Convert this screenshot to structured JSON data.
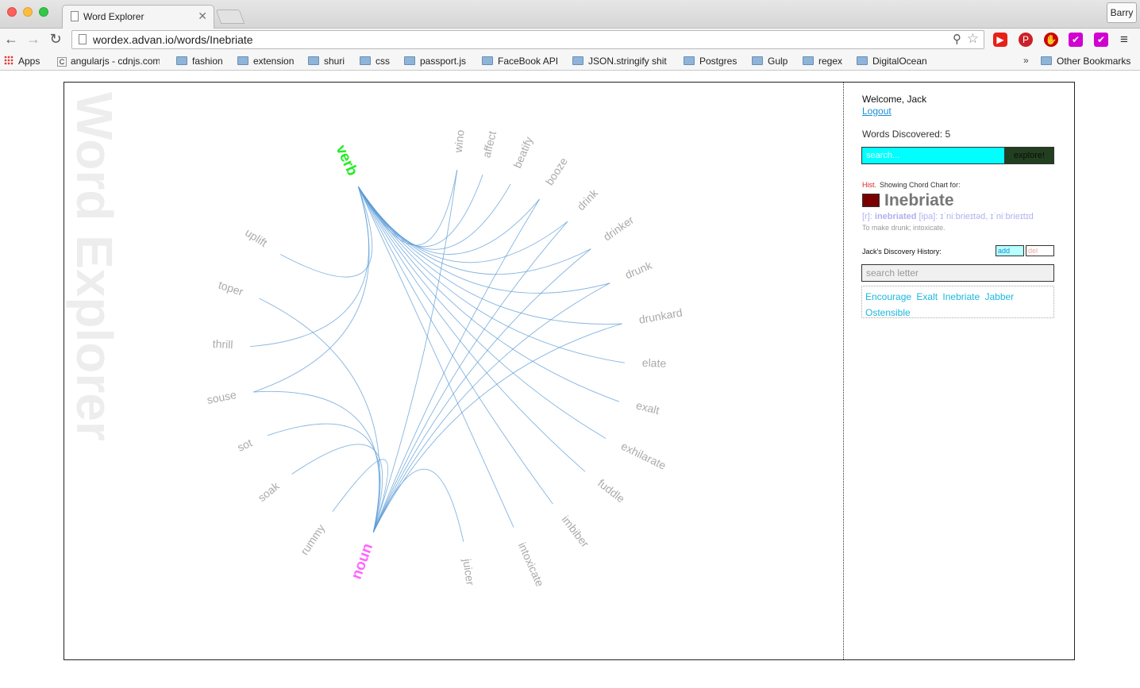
{
  "browser": {
    "tab_title": "Word Explorer",
    "profile": "Barry",
    "url": "wordex.advan.io/words/Inebriate",
    "bookmarks": [
      {
        "label": "Apps",
        "kind": "apps"
      },
      {
        "label": "angularjs - cdnjs.com",
        "kind": "page"
      },
      {
        "label": "fashion",
        "kind": "folder"
      },
      {
        "label": "extension",
        "kind": "folder"
      },
      {
        "label": "shuri",
        "kind": "folder"
      },
      {
        "label": "css",
        "kind": "folder"
      },
      {
        "label": "passport.js",
        "kind": "folder"
      },
      {
        "label": "FaceBook API",
        "kind": "folder"
      },
      {
        "label": "JSON.stringify shit",
        "kind": "folder"
      },
      {
        "label": "Postgres",
        "kind": "folder"
      },
      {
        "label": "Gulp",
        "kind": "folder"
      },
      {
        "label": "regex",
        "kind": "folder"
      },
      {
        "label": "DigitalOcean",
        "kind": "folder"
      }
    ],
    "bookmarks_more": "»",
    "other_bookmarks": "Other Bookmarks"
  },
  "app": {
    "watermark": "Word Explorer",
    "panel": {
      "welcome": "Welcome, Jack",
      "logout": "Logout",
      "words_discovered": "Words Discovered: 5",
      "search_placeholder": "search...",
      "explore_label": "explore!",
      "hist_tag": "Hist.",
      "showing": "Showing Chord Chart for:",
      "word": "Inebriate",
      "word_color": "#7a0000",
      "pron_prefix": "[r]:",
      "pron_r": "inebriated",
      "pron_ipa_label": "[ipa]:",
      "pron_ipa": "ɪˈniːbrieɪtəd, ɪˈniːbrieɪtɪd",
      "definition": "To make drunk; intoxicate.",
      "history_label": "Jack's Discovery History:",
      "add_label": "add",
      "del_label": "del",
      "letter_placeholder": "search letter",
      "history_words": [
        "Encourage",
        "Exalt",
        "Inebriate",
        "Jabber",
        "Ostensible"
      ]
    }
  },
  "chord": {
    "verb": {
      "label": "verb",
      "color": "#22ee22"
    },
    "noun": {
      "label": "noun",
      "color": "#ff66ff"
    },
    "words": [
      "wino",
      "affect",
      "beatify",
      "booze",
      "drink",
      "drinker",
      "drunk",
      "drunkard",
      "elate",
      "exalt",
      "exhilarate",
      "fuddle",
      "imbiber",
      "intoxicate",
      "juicer",
      "rummy",
      "soak",
      "sot",
      "souse",
      "thrill",
      "toper",
      "uplift"
    ],
    "angles": [
      -84,
      -76,
      -67,
      -57,
      -46,
      -35,
      -23,
      -10,
      2,
      14,
      26,
      38,
      52,
      66,
      82,
      124,
      141,
      155,
      169,
      183,
      198,
      213
    ],
    "links": {
      "verb": [
        "affect",
        "beatify",
        "booze",
        "drink",
        "drinker",
        "drunk",
        "drunkard",
        "elate",
        "exalt",
        "exhilarate",
        "fuddle",
        "imbiber",
        "intoxicate",
        "souse",
        "thrill",
        "uplift",
        "wino"
      ],
      "noun": [
        "wino",
        "booze",
        "drink",
        "drinker",
        "drunk",
        "drunkard",
        "juicer",
        "rummy",
        "soak",
        "sot",
        "souse",
        "toper"
      ]
    },
    "link_color": "#5b9bd5"
  }
}
